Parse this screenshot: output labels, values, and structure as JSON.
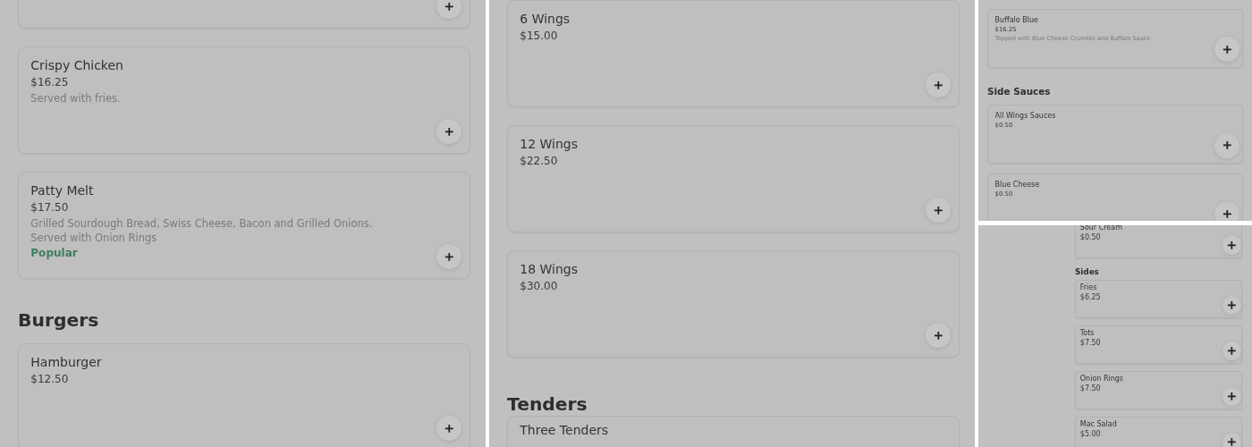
{
  "panels": [
    {
      "items": [
        {
          "kind": "card"
        },
        {
          "kind": "card",
          "name": "Crispy Chicken",
          "price": "$16.25",
          "description": "Served with fries."
        },
        {
          "kind": "card",
          "name": "Patty Melt",
          "price": "$17.50",
          "description": "Grilled Sourdough Bread, Swiss Cheese, Bacon and Grilled Onions.",
          "description_2": "Served with Onion Rings",
          "badge": "Popular"
        },
        {
          "kind": "heading",
          "title": "Burgers"
        },
        {
          "kind": "card",
          "name": "Hamburger",
          "price": "$12.50"
        }
      ]
    },
    {
      "items": [
        {
          "kind": "card",
          "name": "6 Wings",
          "price": "$15.00"
        },
        {
          "kind": "card",
          "name": "12 Wings",
          "price": "$22.50"
        },
        {
          "kind": "card",
          "name": "18 Wings",
          "price": "$30.00"
        },
        {
          "kind": "heading",
          "title": "Tenders"
        },
        {
          "kind": "card",
          "name": "Three Tenders"
        }
      ]
    },
    {
      "items": [
        {
          "kind": "card",
          "name": "Buffalo Blue",
          "price": "$16.25",
          "description": "Topped with Blue Cheese Crumble and Buffalo Sauce"
        },
        {
          "kind": "heading",
          "title": "Side Sauces"
        },
        {
          "kind": "card",
          "name": "All Wings Sauces",
          "price": "$0.50"
        },
        {
          "kind": "card",
          "name": "Blue Cheese",
          "price": "$0.50"
        }
      ]
    },
    {
      "items": [
        {
          "kind": "card",
          "name": "Sour Cream",
          "price": "$0.50"
        },
        {
          "kind": "heading",
          "title": "Sides"
        },
        {
          "kind": "card",
          "name": "Fries",
          "price": "$6.25"
        },
        {
          "kind": "card",
          "name": "Tots",
          "price": "$7.50"
        },
        {
          "kind": "card",
          "name": "Onion Rings",
          "price": "$7.50"
        },
        {
          "kind": "card",
          "name": "Mac Salad",
          "price": "$5.00"
        }
      ]
    }
  ]
}
